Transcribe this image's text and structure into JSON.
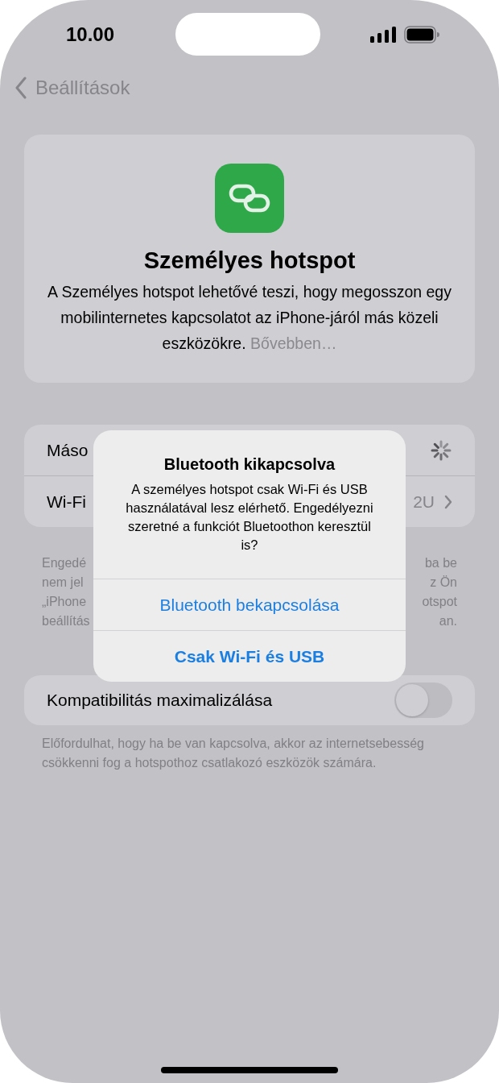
{
  "status_bar": {
    "time": "10.00"
  },
  "nav": {
    "back_label": "Beállítások"
  },
  "header": {
    "title": "Személyes hotspot",
    "description": "A Személyes hotspot lehetővé teszi, hogy megosszon egy mobilinternetes kapcsolatot az iPhone-járól más közeli eszközökre.",
    "link": "Bővebben…"
  },
  "rows": [
    {
      "kind": "loading",
      "label": "Máso"
    },
    {
      "kind": "value",
      "label": "Wi-Fi",
      "value": "2U"
    }
  ],
  "rows_footer": {
    "left_lines": [
      "Engedé",
      "nem jel",
      "„iPhone",
      "beállítás"
    ],
    "right_lines": [
      "ba be",
      "z Ön",
      "otspot",
      "an."
    ]
  },
  "toggle_row": {
    "label": "Kompatibilitás maximalizálása",
    "on": false
  },
  "toggle_footer": "Előfordulhat, hogy ha be van kapcsolva, akkor az internetsebesség csökkenni fog a hotspothoz csatlakozó eszközök számára.",
  "alert": {
    "title": "Bluetooth kikapcsolva",
    "message": "A személyes hotspot csak Wi-Fi és USB használatával lesz elérhető. Engedélyezni szeretné a funkciót Bluetoothon keresztül is?",
    "buttons": [
      {
        "label": "Bluetooth bekapcsolása",
        "kind": "normal"
      },
      {
        "label": "Csak Wi-Fi és USB",
        "kind": "preferred"
      }
    ]
  }
}
